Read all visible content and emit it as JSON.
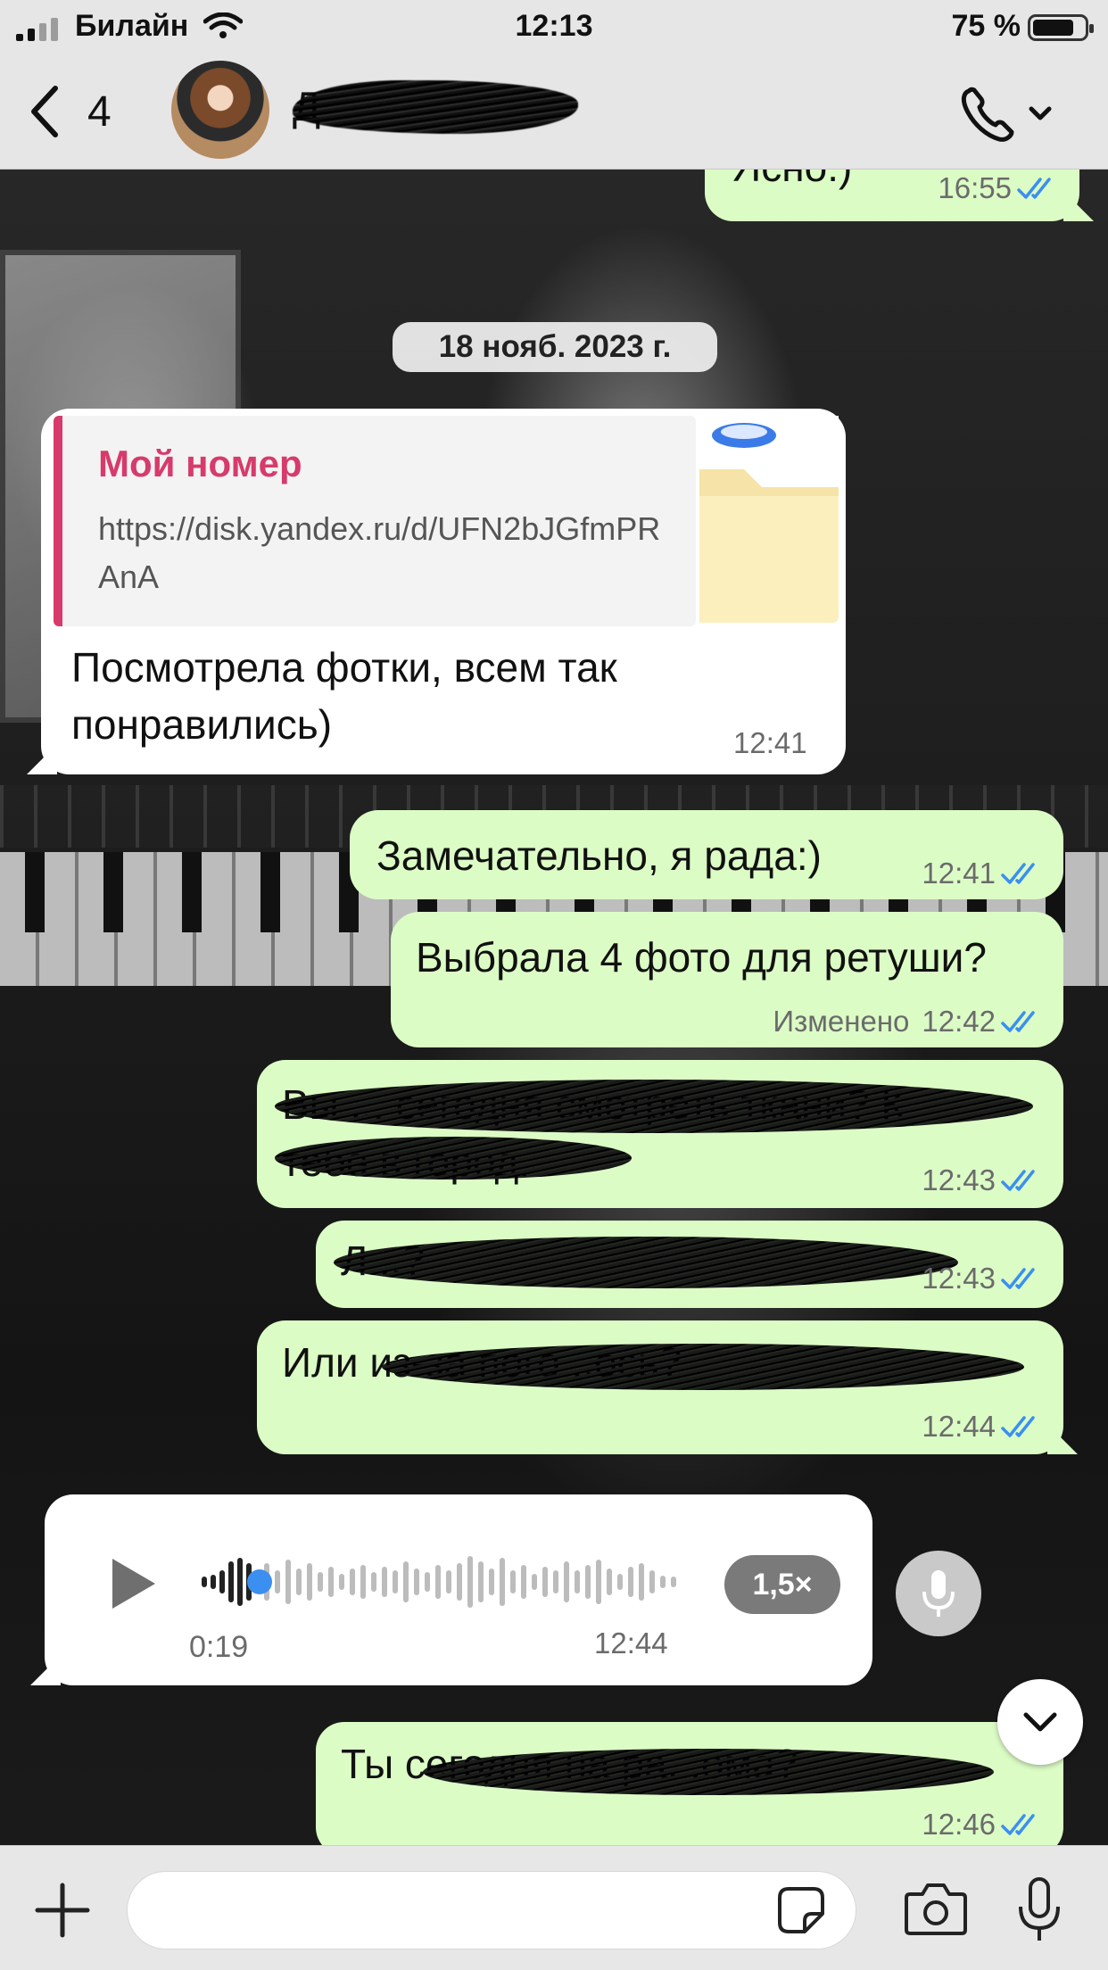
{
  "status_bar": {
    "carrier": "Билайн",
    "time": "12:13",
    "battery": "75 %"
  },
  "header": {
    "back_count": "4",
    "contact_name": "Д"
  },
  "chat": {
    "date_divider": "18 нояб. 2023 г.",
    "messages": [
      {
        "dir": "out",
        "text": "Ясно:)",
        "time": "16:55",
        "read": true
      },
      {
        "dir": "in",
        "link_title": "Мой номер",
        "link_url": "https://disk.yandex.ru/d/UFN2bJGfmPRAnA",
        "text": "Посмотрела фотки, всем так понравились)",
        "time": "12:41"
      },
      {
        "dir": "out",
        "text": "Замечательно, я рада:)",
        "time": "12:41",
        "read": true
      },
      {
        "dir": "out",
        "text": "Выбрала 4 фото для ретуши?",
        "edited": "Изменено",
        "time": "12:42",
        "read": true
      },
      {
        "dir": "out",
        "text": "Вы ... сегодня смотреть ткани? К тебе в город.",
        "time": "12:43",
        "read": true
      },
      {
        "dir": "out",
        "text": "Л...?",
        "time": "12:43",
        "read": true
      },
      {
        "dir": "out",
        "text": "Или из-за пого...ось?",
        "time": "12:44",
        "read": true
      },
      {
        "dir": "in",
        "voice": true,
        "duration": "0:19",
        "time": "12:44",
        "speed": "1,5×"
      },
      {
        "dir": "out",
        "text": "Ты сегодня на ра...ома?",
        "time": "12:46",
        "read": true
      }
    ]
  },
  "composer": {
    "placeholder": ""
  },
  "colors": {
    "outgoing_bubble": "#dcfcc6",
    "incoming_bubble": "#ffffff",
    "link_accent": "#d63b6c",
    "read_ticks": "#3b8ff0"
  }
}
